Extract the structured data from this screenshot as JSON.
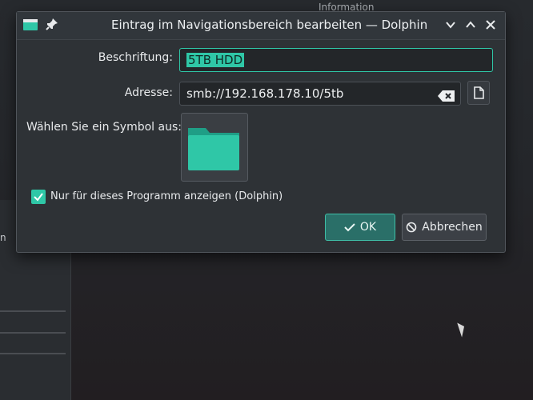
{
  "background": {
    "info_text": "Information",
    "left_text": "n"
  },
  "titlebar": {
    "title": "Eintrag im Navigationsbereich bearbeiten — Dolphin",
    "app_icon": "folder-icon",
    "pin_icon": "pin-icon",
    "buttons": [
      "minimize-icon",
      "maximize-icon",
      "close-icon"
    ]
  },
  "form": {
    "label_caption": "Beschriftung:",
    "caption_value": "5TB HDD",
    "label_address": "Adresse:",
    "address_value": "smb://192.168.178.10/5tb",
    "label_symbol": "Wählen Sie ein Symbol aus:",
    "symbol_icon": "folder-icon",
    "checkbox_label": "Nur für dieses Programm anzeigen (Dolphin)",
    "checkbox_checked": true
  },
  "buttons": {
    "ok": "OK",
    "cancel": "Abbrechen"
  },
  "colors": {
    "accent": "#2fc7a7",
    "dialog_bg": "#2e3236",
    "field_bg": "#232629"
  }
}
